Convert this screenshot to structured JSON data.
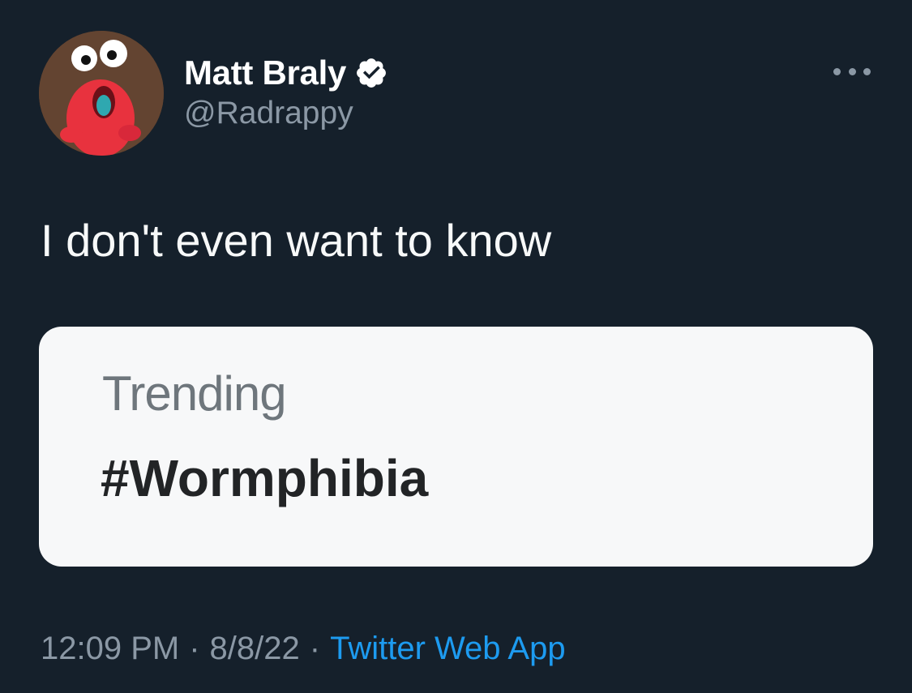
{
  "tweet": {
    "author": {
      "display_name": "Matt Braly",
      "handle": "@Radrappy",
      "verified": true,
      "avatar_icon": "avatar"
    },
    "more_icon": "more-options-icon",
    "text": "I don't even want to know",
    "media": {
      "trend_label": "Trending",
      "trend_tag": "#Wormphibia"
    },
    "meta": {
      "time": "12:09 PM",
      "date": "8/8/22",
      "separator": "·",
      "source": "Twitter Web App"
    }
  },
  "colors": {
    "background": "#15202b",
    "accent": "#1d9bf0",
    "secondary_text": "#8b98a5",
    "card_background": "#f7f8f9"
  }
}
